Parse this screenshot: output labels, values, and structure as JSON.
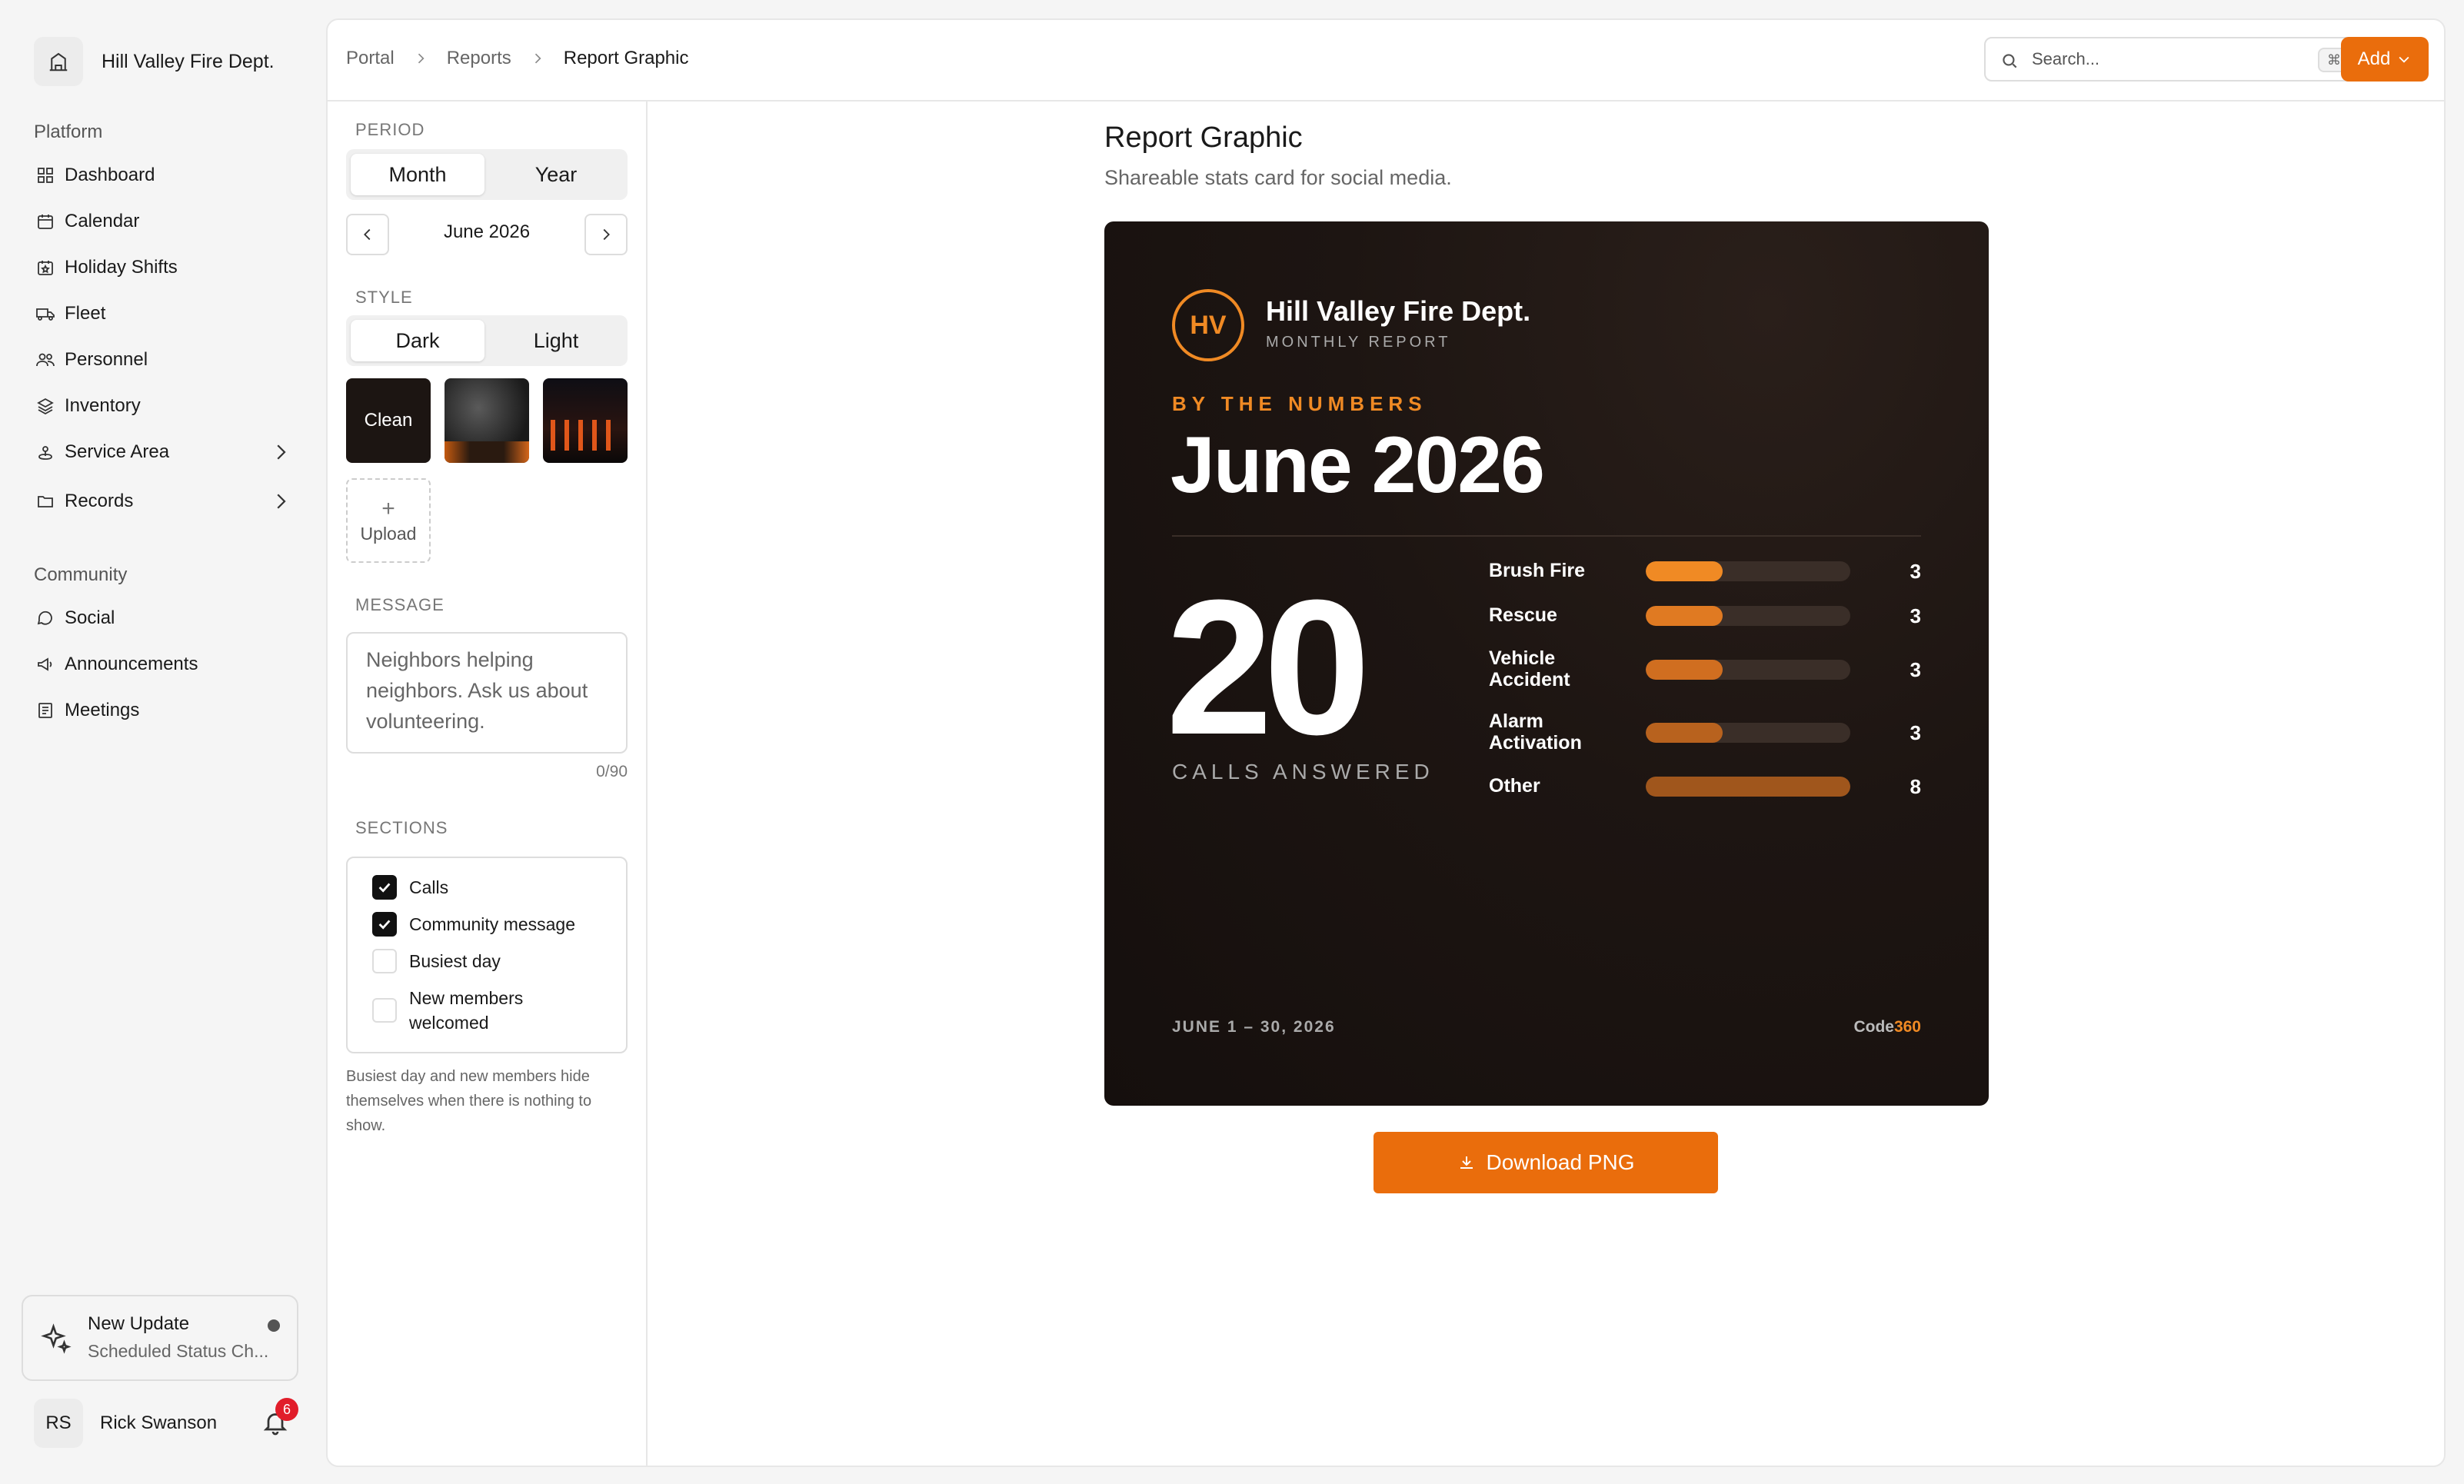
{
  "org": {
    "name": "Hill Valley Fire Dept."
  },
  "sidebar": {
    "platform_label": "Platform",
    "platform_items": [
      {
        "label": "Dashboard",
        "icon": "dashboard-icon"
      },
      {
        "label": "Calendar",
        "icon": "calendar-icon"
      },
      {
        "label": "Holiday Shifts",
        "icon": "holiday-icon"
      },
      {
        "label": "Fleet",
        "icon": "truck-icon"
      },
      {
        "label": "Personnel",
        "icon": "users-icon"
      },
      {
        "label": "Inventory",
        "icon": "layers-icon"
      },
      {
        "label": "Service Area",
        "icon": "map-pin-icon"
      },
      {
        "label": "Records",
        "icon": "folder-icon"
      }
    ],
    "community_label": "Community",
    "community_items": [
      {
        "label": "Social",
        "icon": "chat-icon"
      },
      {
        "label": "Announcements",
        "icon": "megaphone-icon"
      },
      {
        "label": "Meetings",
        "icon": "notes-icon"
      }
    ],
    "update": {
      "title": "New Update",
      "subtitle": "Scheduled Status Ch..."
    },
    "user": {
      "initials": "RS",
      "name": "Rick Swanson",
      "notifications": "6"
    }
  },
  "breadcrumb": [
    "Portal",
    "Reports",
    "Report Graphic"
  ],
  "search": {
    "placeholder": "Search...",
    "shortcut": "⌘K"
  },
  "add_button": "Add",
  "panel": {
    "period_label": "PERIOD",
    "period_options": [
      "Month",
      "Year"
    ],
    "period_value": "June 2026",
    "style_label": "STYLE",
    "style_options": [
      "Dark",
      "Light"
    ],
    "background_clean": "Clean",
    "upload_label": "Upload",
    "message_label": "MESSAGE",
    "message_text": "Neighbors helping neighbors. Ask us about volunteering.",
    "message_counter": "0/90",
    "sections_label": "SECTIONS",
    "sections": [
      {
        "label": "Calls",
        "checked": true
      },
      {
        "label": "Community message",
        "checked": true
      },
      {
        "label": "Busiest day",
        "checked": false
      },
      {
        "label": "New members welcomed",
        "checked": false
      }
    ],
    "note": "Busiest day and new members hide themselves when there is nothing to show."
  },
  "page": {
    "title": "Report Graphic",
    "subtitle": "Shareable stats card for social media."
  },
  "card": {
    "logo": "HV",
    "org": "Hill Valley Fire Dept.",
    "kicker": "MONTHLY REPORT",
    "by_the_numbers": "BY THE NUMBERS",
    "month": "June 2026",
    "total": "20",
    "total_label": "CALLS ANSWERED",
    "categories": [
      {
        "label": "Brush Fire",
        "value": 3,
        "color": "#f08a24"
      },
      {
        "label": "Rescue",
        "value": 3,
        "color": "#e07a22"
      },
      {
        "label": "Vehicle Accident",
        "value": 3,
        "color": "#d06e20"
      },
      {
        "label": "Alarm Activation",
        "value": 3,
        "color": "#b8621e"
      },
      {
        "label": "Other",
        "value": 8,
        "color": "#a0561c"
      }
    ],
    "dates": "JUNE 1 – 30, 2026",
    "brand_a": "Code",
    "brand_b": "360"
  },
  "download_label": "Download PNG",
  "colors": {
    "accent": "#ea6d0c",
    "card_accent": "#f08a24"
  }
}
